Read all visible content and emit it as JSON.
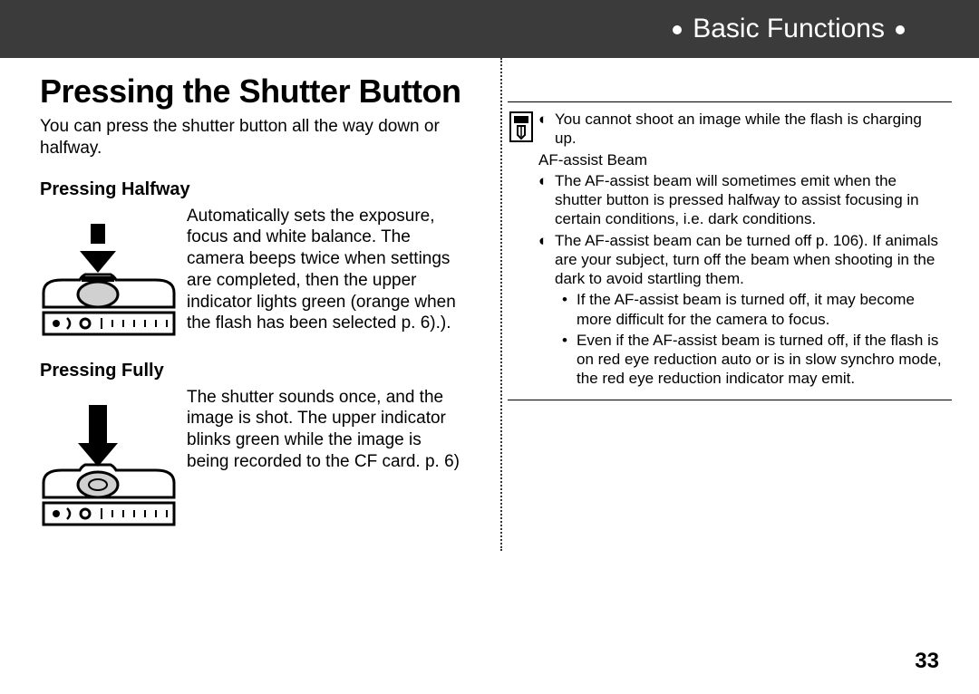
{
  "header": {
    "title": "Basic Functions"
  },
  "page_title": "Pressing the Shutter Button",
  "intro": "You can press the shutter button all the way down or halfway.",
  "halfway": {
    "heading": "Pressing Halfway",
    "text": "Automatically sets the exposure, focus and white balance. The camera beeps twice when settings are completed, then the upper indicator lights green (orange when the flash has been selected p. 6).)."
  },
  "fully": {
    "heading": "Pressing Fully",
    "text": "The shutter sounds once, and the image is shot.  The upper indicator blinks green while the image is being recorded to the CF card. p. 6)"
  },
  "notes": {
    "b1": "You cannot shoot an image while the flash is charging up.",
    "af_heading": "AF-assist Beam",
    "b2": "The AF-assist beam will sometimes emit when the shutter button is pressed halfway to assist focusing in certain conditions, i.e. dark conditions.",
    "b3": "The AF-assist beam can be turned off p. 106). If animals are your subject, turn off the beam when shooting in the dark to avoid startling them.",
    "s1": "If the AF-assist beam is turned off, it may become more difficult for the camera to focus.",
    "s2": "Even if the AF-assist beam is turned off, if the flash is on red eye reduction auto or is in slow synchro mode, the red eye reduction indicator may emit."
  },
  "page_number": "33"
}
